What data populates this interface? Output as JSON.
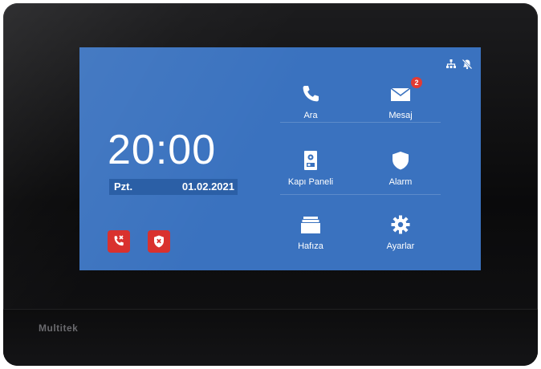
{
  "brand": "Multitek",
  "clock": {
    "time": "20:00",
    "day": "Pzt.",
    "date": "01.02.2021"
  },
  "tiles": {
    "call": {
      "label": "Ara",
      "icon": "phone-icon"
    },
    "message": {
      "label": "Mesaj",
      "icon": "mail-icon",
      "badge": "2"
    },
    "door_panel": {
      "label": "Kapı Paneli",
      "icon": "door-panel-icon"
    },
    "alarm": {
      "label": "Alarm",
      "icon": "shield-icon"
    },
    "memory": {
      "label": "Hafıza",
      "icon": "archive-icon"
    },
    "settings": {
      "label": "Ayarlar",
      "icon": "gear-icon"
    }
  },
  "status": {
    "icons": [
      "network-icon",
      "bell-muted-icon"
    ],
    "buttons": [
      "call-forward-off-icon",
      "alarm-off-icon"
    ]
  },
  "colors": {
    "screen": "#3a72bf",
    "alert": "#d9312e",
    "badge": "#e23b33"
  }
}
